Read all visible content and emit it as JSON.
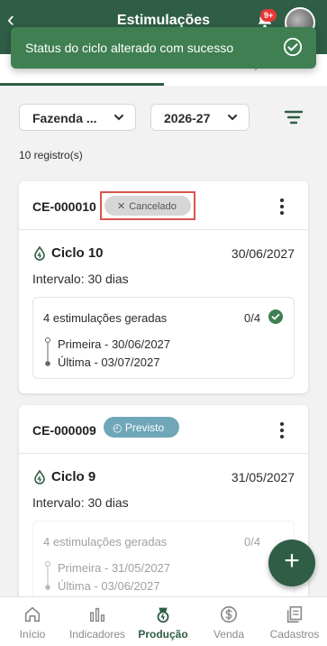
{
  "header": {
    "title": "Estimulações",
    "notification_badge": "9+"
  },
  "toast": {
    "message": "Status do ciclo alterado com sucesso"
  },
  "filters": {
    "farm": "Fazenda ...",
    "year": "2026-27"
  },
  "records_count": "10 registro(s)",
  "cards": [
    {
      "code": "CE-000010",
      "status": "Cancelado",
      "status_color": "#d6d6d6",
      "cycle": "Ciclo 10",
      "date": "30/06/2027",
      "interval": "Intervalo: 30 dias",
      "stimulations": "4 estimulações geradas",
      "count": "0/4",
      "first": "Primeira - 30/06/2027",
      "last": "Última - 03/07/2027"
    },
    {
      "code": "CE-000009",
      "status": "Previsto",
      "status_color": "#6fa6b8",
      "cycle": "Ciclo 9",
      "date": "31/05/2027",
      "interval": "Intervalo: 30 dias",
      "stimulations": "4 estimulações geradas",
      "count": "0/4",
      "first": "Primeira - 31/05/2027",
      "last": "Última - 03/06/2027"
    }
  ],
  "fab": {
    "label": "+"
  },
  "nav": {
    "items": [
      {
        "label": "Início",
        "icon": "home-icon"
      },
      {
        "label": "Indicadores",
        "icon": "chart-icon"
      },
      {
        "label": "Produção",
        "icon": "production-icon"
      },
      {
        "label": "Venda",
        "icon": "dollar-icon"
      },
      {
        "label": "Cadastros",
        "icon": "records-icon"
      }
    ],
    "active": "Produção"
  },
  "colors": {
    "primary": "#2f5d45",
    "toast": "#3f7f52",
    "check": "#3f7f52"
  }
}
